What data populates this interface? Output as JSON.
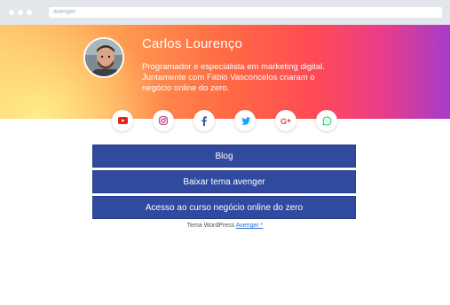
{
  "browser": {
    "url": "avenger"
  },
  "profile": {
    "name": "Carlos Lourenço",
    "bio": "Programador e especialista em marketing digital. Juntamente com Fábio Vasconcelos criaram o negócio online do zero."
  },
  "social_links": [
    {
      "icon": "youtube-icon",
      "color": "#e62117"
    },
    {
      "icon": "instagram-icon",
      "color": "#c13584"
    },
    {
      "icon": "facebook-icon",
      "color": "#3b5998"
    },
    {
      "icon": "twitter-icon",
      "color": "#1da1f2"
    },
    {
      "icon": "google-plus-icon",
      "color": "#dd4b39"
    },
    {
      "icon": "whatsapp-icon",
      "color": "#25d366"
    }
  ],
  "links": [
    {
      "label": "Blog"
    },
    {
      "label": "Baixar tema avenger"
    },
    {
      "label": "Acesso ao curso negócio online do zero"
    }
  ],
  "footer": {
    "prefix": "Tema WordPress",
    "link_label": "Avenger *"
  },
  "colors": {
    "button_bg": "#2f4a9e",
    "link": "#2f6fd6"
  }
}
